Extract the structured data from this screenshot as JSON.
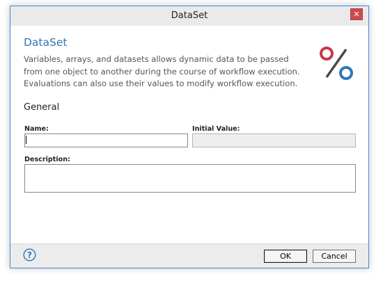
{
  "window": {
    "title": "DataSet",
    "close_glyph": "✕"
  },
  "header": {
    "title": "DataSet",
    "description": "Variables, arrays, and datasets allows dynamic data to be passed from one object to another during the course of workflow execution. Evaluations can also use their values to modify workflow execution.",
    "logo_icon": "percent-icon",
    "logo_colors": {
      "top_circle": "#c8374a",
      "slash": "#4a4a4a",
      "bottom_circle": "#2f78b7"
    }
  },
  "section": {
    "title": "General"
  },
  "fields": {
    "name": {
      "label": "Name:",
      "value": ""
    },
    "initial_value": {
      "label": "Initial Value:",
      "value": ""
    },
    "description": {
      "label": "Description:",
      "value": ""
    }
  },
  "footer": {
    "help_icon": "help-icon",
    "help_glyph": "?",
    "ok_label": "OK",
    "cancel_label": "Cancel"
  },
  "colors": {
    "accent": "#2e74b5",
    "window_border": "#3f8bd6",
    "close_button": "#c94c4c"
  }
}
